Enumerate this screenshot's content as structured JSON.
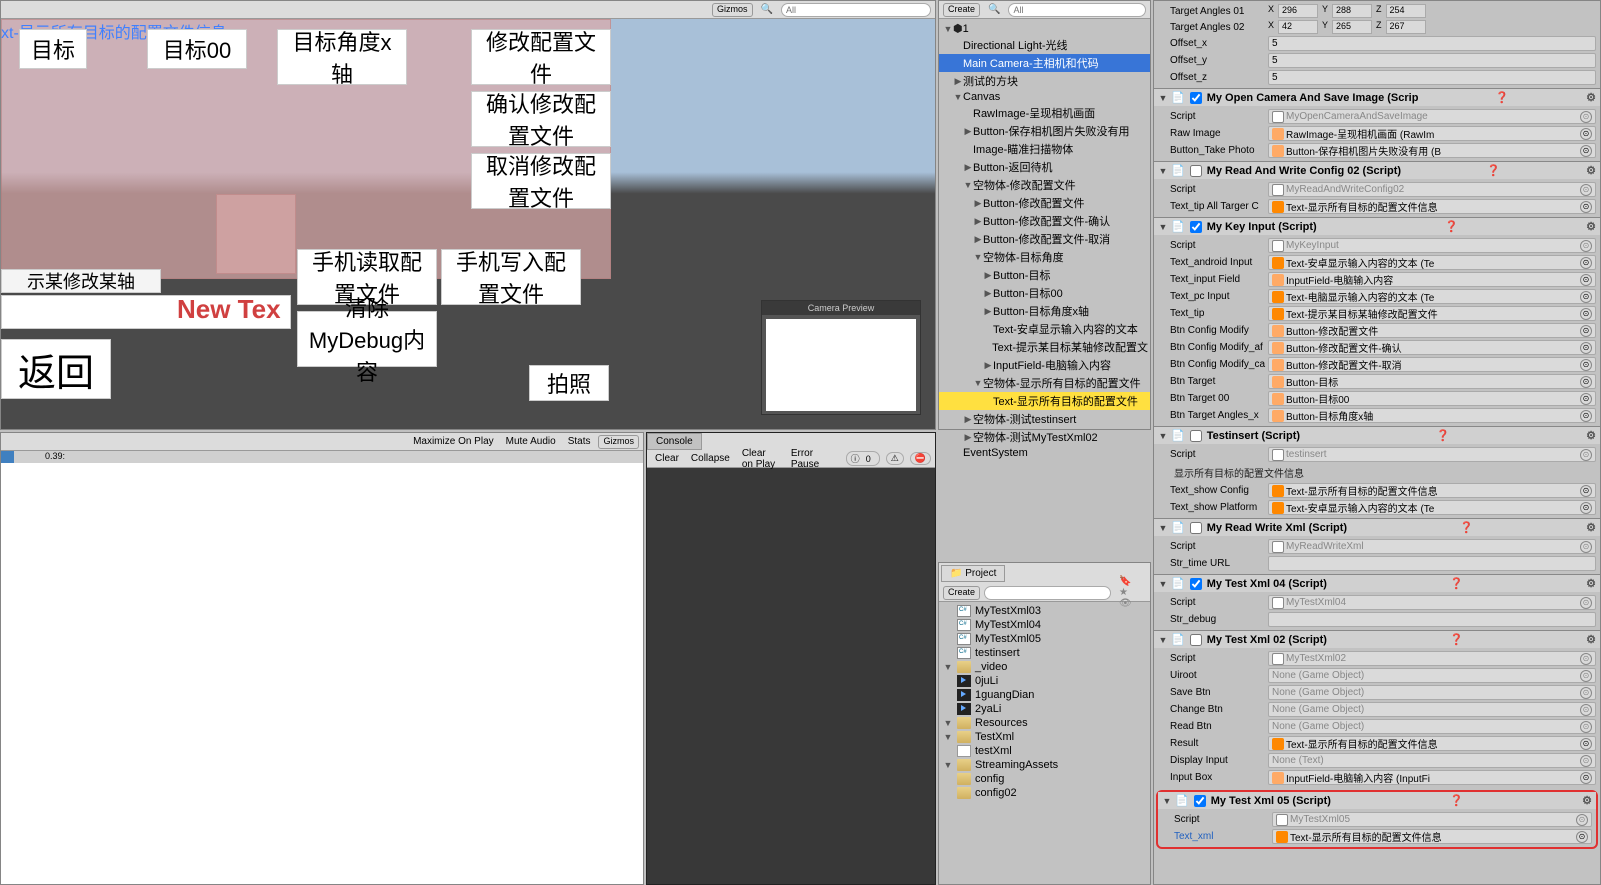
{
  "scene": {
    "gizmos_label": "Gizmos",
    "search_placeholder": "All",
    "blue_text": "xt-显示所有目标的配置文件信息",
    "btns": {
      "target": "目标",
      "target00": "目标00",
      "target_angle_x": "目标角度x轴",
      "modify_cfg": "修改配置文件",
      "confirm_cfg": "确认修改配置文件",
      "cancel_cfg": "取消修改配置文件",
      "phone_read": "手机读取配置文件",
      "phone_write": "手机写入配置文件",
      "clear_debug": "清除MyDebug内容",
      "take_photo": "拍照",
      "back": "返回",
      "tip": "示某修改某轴"
    },
    "newtext": "New Tex",
    "camera_preview": "Camera Preview"
  },
  "game": {
    "maximize": "Maximize On Play",
    "mute": "Mute Audio",
    "stats": "Stats",
    "gizmos": "Gizmos",
    "progress_label": "0.39:"
  },
  "console": {
    "tab": "Console",
    "clear": "Clear",
    "collapse": "Collapse",
    "clear_on_play": "Clear on Play",
    "error_pause": "Error Pause",
    "count0": "0"
  },
  "hierarchy": {
    "create": "Create",
    "search_placeholder": "All",
    "items": [
      {
        "d": 0,
        "f": "▼",
        "t": "1",
        "ico": "u"
      },
      {
        "d": 1,
        "f": "",
        "t": "Directional Light-光线"
      },
      {
        "d": 1,
        "f": "",
        "t": "Main Camera-主相机和代码",
        "sel": true
      },
      {
        "d": 1,
        "f": "▶",
        "t": "测试的方块"
      },
      {
        "d": 1,
        "f": "▼",
        "t": "Canvas"
      },
      {
        "d": 2,
        "f": "",
        "t": "RawImage-呈现相机画面"
      },
      {
        "d": 2,
        "f": "▶",
        "t": "Button-保存相机图片失败没有用"
      },
      {
        "d": 2,
        "f": "",
        "t": "Image-瞄准扫描物体"
      },
      {
        "d": 2,
        "f": "▶",
        "t": "Button-返回待机"
      },
      {
        "d": 2,
        "f": "▼",
        "t": "空物体-修改配置文件"
      },
      {
        "d": 3,
        "f": "▶",
        "t": "Button-修改配置文件"
      },
      {
        "d": 3,
        "f": "▶",
        "t": "Button-修改配置文件-确认"
      },
      {
        "d": 3,
        "f": "▶",
        "t": "Button-修改配置文件-取消"
      },
      {
        "d": 3,
        "f": "▼",
        "t": "空物体-目标角度"
      },
      {
        "d": 4,
        "f": "▶",
        "t": "Button-目标"
      },
      {
        "d": 4,
        "f": "▶",
        "t": "Button-目标00"
      },
      {
        "d": 4,
        "f": "▶",
        "t": "Button-目标角度x轴"
      },
      {
        "d": 4,
        "f": "",
        "t": "Text-安卓显示输入内容的文本"
      },
      {
        "d": 4,
        "f": "",
        "t": "Text-提示某目标某轴修改配置文"
      },
      {
        "d": 4,
        "f": "▶",
        "t": "InputField-电脑输入内容"
      },
      {
        "d": 3,
        "f": "▼",
        "t": "空物体-显示所有目标的配置文件"
      },
      {
        "d": 4,
        "f": "",
        "t": "Text-显示所有目标的配置文件",
        "hl": true
      },
      {
        "d": 2,
        "f": "▶",
        "t": "空物体-测试testinsert"
      },
      {
        "d": 2,
        "f": "▶",
        "t": "空物体-测试MyTestXml02"
      },
      {
        "d": 1,
        "f": "",
        "t": "EventSystem"
      }
    ]
  },
  "project": {
    "tab": "Project",
    "create": "Create",
    "items": [
      {
        "d": 2,
        "i": "cs",
        "t": "MyTestXml03"
      },
      {
        "d": 2,
        "i": "cs",
        "t": "MyTestXml04"
      },
      {
        "d": 2,
        "i": "cs",
        "t": "MyTestXml05"
      },
      {
        "d": 2,
        "i": "cs",
        "t": "testinsert"
      },
      {
        "d": 1,
        "i": "folder",
        "t": "_video",
        "f": "▼"
      },
      {
        "d": 2,
        "i": "vid",
        "t": "0juLi"
      },
      {
        "d": 2,
        "i": "vid",
        "t": "1guangDian"
      },
      {
        "d": 2,
        "i": "vid",
        "t": "2yaLi"
      },
      {
        "d": 1,
        "i": "folder",
        "t": "Resources",
        "f": "▼"
      },
      {
        "d": 2,
        "i": "folder",
        "t": "TestXml",
        "f": "▼"
      },
      {
        "d": 3,
        "i": "file",
        "t": "testXml"
      },
      {
        "d": 1,
        "i": "folder",
        "t": "StreamingAssets",
        "f": "▼"
      },
      {
        "d": 2,
        "i": "folder",
        "t": "config"
      },
      {
        "d": 2,
        "i": "folder",
        "t": "config02"
      }
    ]
  },
  "inspector": {
    "top": {
      "target_angles_01": "Target Angles 01",
      "ta01": {
        "x": "296",
        "y": "288",
        "z": "254"
      },
      "target_angles_02": "Target Angles 02",
      "ta02": {
        "x": "42",
        "y": "265",
        "z": "267"
      },
      "offset_x": "Offset_x",
      "ox": "5",
      "offset_y": "Offset_y",
      "oy": "5",
      "offset_z": "Offset_z",
      "oz": "5"
    },
    "comp_camera": {
      "title": "My Open Camera And Save Image (Scrip",
      "enabled": true,
      "script": "Script",
      "script_v": "MyOpenCameraAndSaveImage",
      "raw_image": "Raw Image",
      "raw_image_v": "RawImage-呈现相机画面 (RawIm",
      "btn_take": "Button_Take Photo",
      "btn_take_v": "Button-保存相机图片失败没有用 (B"
    },
    "comp_config02": {
      "title": "My Read And Write Config 02 (Script)",
      "enabled": false,
      "script": "Script",
      "script_v": "MyReadAndWriteConfig02",
      "tip": "Text_tip All Targer C",
      "tip_v": "Text-显示所有目标的配置文件信息"
    },
    "comp_keyinput": {
      "title": "My Key Input (Script)",
      "enabled": true,
      "script": "Script",
      "script_v": "MyKeyInput",
      "android": "Text_android Input",
      "android_v": "Text-安卓显示输入内容的文本 (Te",
      "inputf": "Text_input Field",
      "inputf_v": "InputField-电脑输入内容",
      "pc": "Text_pc Input",
      "pc_v": "Text-电脑显示输入内容的文本 (Te",
      "tip": "Text_tip",
      "tip_v": "Text-提示某目标某轴修改配置文件",
      "bcm": "Btn Config Modify",
      "bcm_v": "Button-修改配置文件",
      "bcma": "Btn Config Modify_af",
      "bcma_v": "Button-修改配置文件-确认",
      "bcmc": "Btn Config Modify_ca",
      "bcmc_v": "Button-修改配置文件-取消",
      "bt": "Btn Target",
      "bt_v": "Button-目标",
      "bt00": "Btn Target 00",
      "bt00_v": "Button-目标00",
      "btax": "Btn Target Angles_x",
      "btax_v": "Button-目标角度x轴"
    },
    "comp_testinsert": {
      "title": "Testinsert (Script)",
      "enabled": false,
      "script": "Script",
      "script_v": "testinsert",
      "section": "显示所有目标的配置文件信息",
      "tsc": "Text_show Config",
      "tsc_v": "Text-显示所有目标的配置文件信息",
      "tsp": "Text_show Platform",
      "tsp_v": "Text-安卓显示输入内容的文本 (Te"
    },
    "comp_readxml": {
      "title": "My Read Write Xml (Script)",
      "enabled": false,
      "script": "Script",
      "script_v": "MyReadWriteXml",
      "url": "Str_time URL",
      "url_v": ""
    },
    "comp_xml04": {
      "title": "My Test Xml 04 (Script)",
      "enabled": true,
      "script": "Script",
      "script_v": "MyTestXml04",
      "dbg": "Str_debug",
      "dbg_v": ""
    },
    "comp_xml02": {
      "title": "My Test Xml 02 (Script)",
      "enabled": false,
      "script": "Script",
      "script_v": "MyTestXml02",
      "uiroot": "Uiroot",
      "uiroot_v": "None (Game Object)",
      "save": "Save Btn",
      "save_v": "None (Game Object)",
      "change": "Change Btn",
      "change_v": "None (Game Object)",
      "read": "Read Btn",
      "read_v": "None (Game Object)",
      "result": "Result",
      "result_v": "Text-显示所有目标的配置文件信息",
      "disp": "Display Input",
      "disp_v": "None (Text)",
      "ibox": "Input Box",
      "ibox_v": "InputField-电脑输入内容 (InputFi"
    },
    "comp_xml05": {
      "title": "My Test Xml 05 (Script)",
      "enabled": true,
      "script": "Script",
      "script_v": "MyTestXml05",
      "txml": "Text_xml",
      "txml_v": "Text-显示所有目标的配置文件信息"
    }
  }
}
